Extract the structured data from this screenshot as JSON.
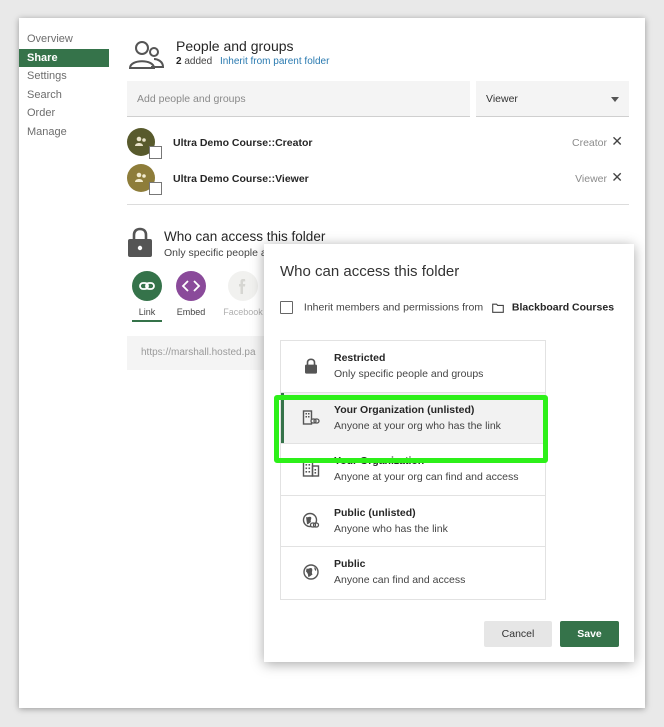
{
  "sidebar": {
    "items": [
      {
        "label": "Overview"
      },
      {
        "label": "Share"
      },
      {
        "label": "Settings"
      },
      {
        "label": "Search"
      },
      {
        "label": "Order"
      },
      {
        "label": "Manage"
      }
    ],
    "active_index": 1
  },
  "people_groups": {
    "title": "People and groups",
    "count": "2",
    "added_label": "added",
    "inherit_link": "Inherit from parent folder"
  },
  "add_people": {
    "placeholder": "Add people and groups",
    "role_value": "Viewer"
  },
  "members": [
    {
      "name": "Ultra Demo Course::Creator",
      "role": "Creator",
      "avatar_color": "#585a2c"
    },
    {
      "name": "Ultra Demo Course::Viewer",
      "role": "Viewer",
      "avatar_color": "#8e7d3a"
    }
  ],
  "access": {
    "title": "Who can access this folder",
    "subtitle": "Only specific people a"
  },
  "share_options": [
    {
      "label": "Link",
      "icon": "link-icon",
      "color": "#35734a"
    },
    {
      "label": "Embed",
      "icon": "embed-icon",
      "color": "#8a4a9a"
    },
    {
      "label": "Facebook",
      "icon": "facebook-icon",
      "color": "#f1f1ef"
    }
  ],
  "link_url": "https://marshall.hosted.pa",
  "dialog": {
    "title": "Who can access this folder",
    "inherit_text": "Inherit members and permissions from",
    "folder_name": "Blackboard Courses",
    "options": [
      {
        "title": "Restricted",
        "subtitle": "Only specific people and groups",
        "icon": "lock-icon"
      },
      {
        "title": "Your Organization (unlisted)",
        "subtitle": "Anyone at your org who has the link",
        "icon": "building-link-icon"
      },
      {
        "title": "Your Organization",
        "subtitle": "Anyone at your org can find and access",
        "icon": "building-icon"
      },
      {
        "title": "Public (unlisted)",
        "subtitle": "Anyone who has the link",
        "icon": "globe-link-icon"
      },
      {
        "title": "Public",
        "subtitle": "Anyone can find and access",
        "icon": "globe-icon"
      }
    ],
    "selected_index": 1,
    "cancel_label": "Cancel",
    "save_label": "Save"
  },
  "colors": {
    "accent": "#35734a",
    "highlight": "#2df019",
    "link": "#2a7ab0"
  }
}
